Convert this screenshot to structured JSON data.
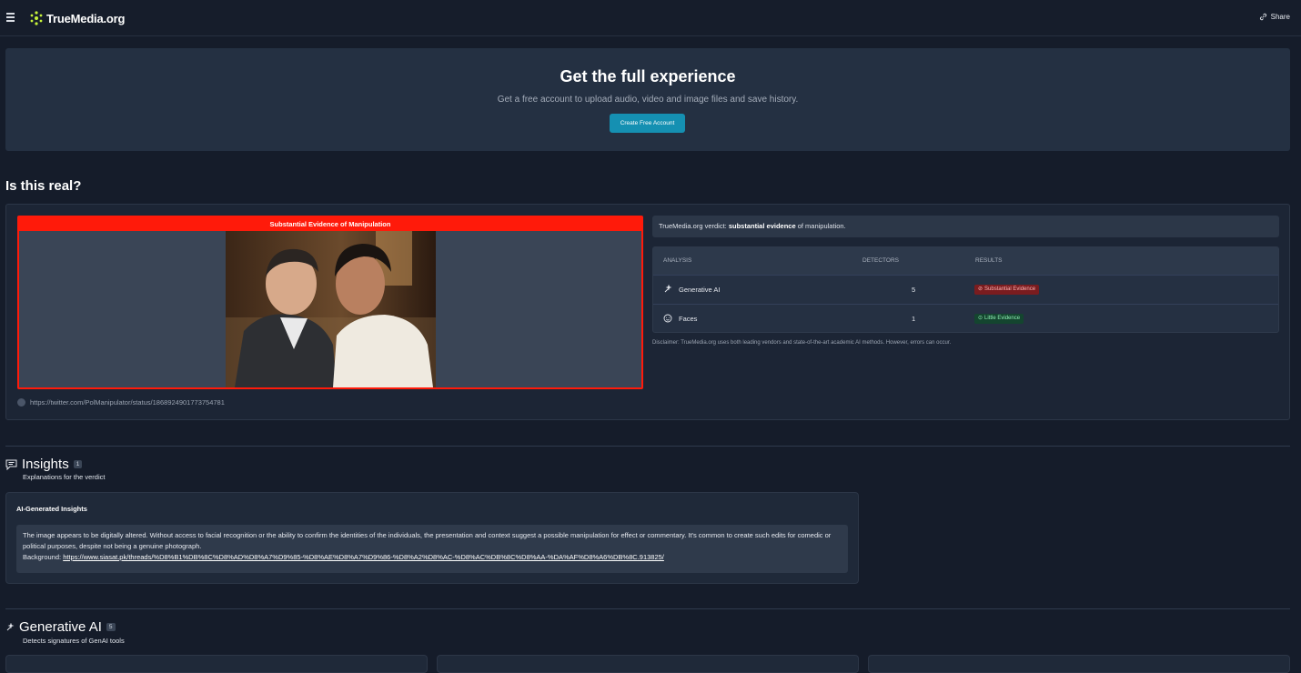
{
  "header": {
    "logo_text": "TrueMedia.org",
    "share_label": "Share"
  },
  "promo": {
    "title": "Get the full experience",
    "subtitle": "Get a free account to upload audio, video and image files and save history.",
    "button_label": "Create Free Account"
  },
  "result": {
    "section_title": "Is this real?",
    "banner": "Substantial Evidence of Manipulation",
    "source_url": "https://twitter.com/PolManipulator/status/1868924901773754781",
    "verdict_prefix": "TrueMedia.org verdict: ",
    "verdict_strong": "substantial evidence",
    "verdict_suffix": " of manipulation.",
    "table": {
      "headers": [
        "ANALYSIS",
        "DETECTORS",
        "RESULTS"
      ],
      "rows": [
        {
          "name": "Generative AI",
          "count": "5",
          "result": "Substantial Evidence",
          "icon": "sparkle-icon",
          "status_color": "#7a1c1f"
        },
        {
          "name": "Faces",
          "count": "1",
          "result": "Little Evidence",
          "icon": "face-icon",
          "status_color": "#14452f"
        }
      ]
    },
    "disclaimer": "Disclaimer: TrueMedia.org uses both leading vendors and state-of-the-art academic AI methods. However, errors can occur."
  },
  "insights": {
    "title": "Insights",
    "count": "1",
    "subtitle": "Explanations for the verdict",
    "card_title": "AI-Generated Insights",
    "body": "The image appears to be digitally altered. Without access to facial recognition or the ability to confirm the identities of the individuals, the presentation and context suggest a possible manipulation for effect or commentary. It's common to create such edits for comedic or political purposes, despite not being a genuine photograph.",
    "background_label": "Background: ",
    "background_link": "https://www.siasat.pk/threads/%D8%B1%DB%8C%D8%AD%D8%A7%D9%85-%D8%AE%D8%A7%D9%86-%D8%A2%D8%AC-%D8%AC%DB%8C%D8%AA-%DA%AF%D8%A6%DB%8C.913825/"
  },
  "genai": {
    "title": "Generative AI",
    "count": "5",
    "subtitle": "Detects signatures of GenAI tools"
  }
}
